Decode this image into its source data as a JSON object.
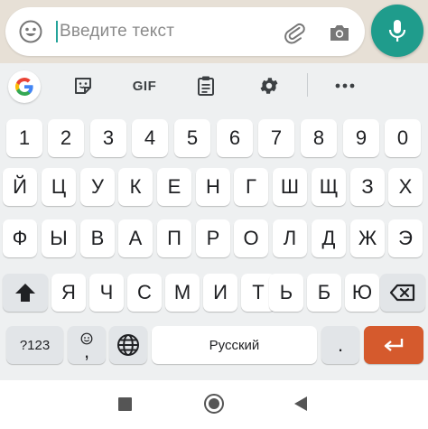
{
  "chat": {
    "placeholder": "Введите текст",
    "icons": [
      "emoji-icon",
      "attach-icon",
      "camera-icon",
      "mic-icon"
    ],
    "accent": "#1f9c8c"
  },
  "toolbar": {
    "items": [
      "google-icon",
      "sticker-icon",
      "gif",
      "clipboard-icon",
      "settings-icon",
      "more-icon"
    ],
    "gif_label": "GIF"
  },
  "keyboard": {
    "row_numbers": [
      "1",
      "2",
      "3",
      "4",
      "5",
      "6",
      "7",
      "8",
      "9",
      "0"
    ],
    "row1": [
      "Й",
      "Ц",
      "У",
      "К",
      "Е",
      "Н",
      "Г",
      "Ш",
      "Щ",
      "З",
      "Х"
    ],
    "row2": [
      "Ф",
      "Ы",
      "В",
      "А",
      "П",
      "Р",
      "О",
      "Л",
      "Д",
      "Ж",
      "Э"
    ],
    "row3": [
      "Я",
      "Ч",
      "С",
      "М",
      "И",
      "Т",
      "Ь",
      "Б",
      "Ю"
    ],
    "symbols_label": "?123",
    "comma": ",",
    "space_label": "Русский",
    "period": ".",
    "enter_color": "#d55a2d"
  },
  "navbar": {
    "buttons": [
      "recents-icon",
      "home-icon",
      "back-icon"
    ]
  }
}
